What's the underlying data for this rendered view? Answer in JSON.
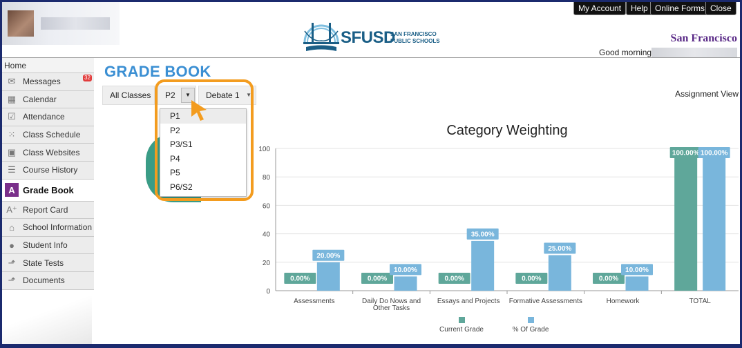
{
  "header": {
    "buttons": [
      "My Account",
      "Help",
      "Online Forms",
      "Close"
    ],
    "logo_text": "SFUSD",
    "logo_sub1": "SAN FRANCISCO",
    "logo_sub2": "PUBLIC SCHOOLS",
    "district": "San Francisco",
    "greeting": "Good morning"
  },
  "sidebar": {
    "home": "Home",
    "messages_badge": "32",
    "items": [
      {
        "label": "Messages",
        "icon": "messages-icon"
      },
      {
        "label": "Calendar",
        "icon": "calendar-icon"
      },
      {
        "label": "Attendance",
        "icon": "attendance-icon"
      },
      {
        "label": "Class Schedule",
        "icon": "class-schedule-icon"
      },
      {
        "label": "Class Websites",
        "icon": "class-websites-icon"
      },
      {
        "label": "Course History",
        "icon": "course-history-icon"
      },
      {
        "label": "Grade Book",
        "icon": "grade-book-icon"
      },
      {
        "label": "Report Card",
        "icon": "report-card-icon"
      },
      {
        "label": "School Information",
        "icon": "school-information-icon"
      },
      {
        "label": "Student Info",
        "icon": "student-info-icon"
      },
      {
        "label": "State Tests",
        "icon": "state-tests-icon"
      },
      {
        "label": "Documents",
        "icon": "documents-icon"
      }
    ]
  },
  "main": {
    "title": "GRADE BOOK",
    "all_classes": "All Classes",
    "period_selected": "P2",
    "class_selected": "Debate 1",
    "assignment_view": "Assignment View",
    "period_options": [
      "P1",
      "P2",
      "P3/S1",
      "P4",
      "P5",
      "P6/S2"
    ]
  },
  "colors": {
    "current_grade": "#5fa79a",
    "percent_of_grade": "#79b6dc",
    "accent_orange": "#f39c1f",
    "title_blue": "#3b8fd3"
  },
  "chart_data": {
    "type": "bar",
    "title": "Category Weighting",
    "categories": [
      "Assessments",
      "Daily Do Nows and Other Tasks",
      "Essays and Projects",
      "Formative Assessments",
      "Homework",
      "TOTAL"
    ],
    "category_labels": [
      [
        "Assessments"
      ],
      [
        "Daily Do Nows and",
        "Other Tasks"
      ],
      [
        "Essays and Projects"
      ],
      [
        "Formative Assessments"
      ],
      [
        "Homework"
      ],
      [
        "TOTAL"
      ]
    ],
    "series": [
      {
        "name": "Current Grade",
        "values": [
          0,
          0,
          0,
          0,
          0,
          100
        ],
        "labels": [
          "0.00%",
          "0.00%",
          "0.00%",
          "0.00%",
          "0.00%",
          "100.00%"
        ]
      },
      {
        "name": "% Of Grade",
        "values": [
          20,
          10,
          35,
          25,
          10,
          100
        ],
        "labels": [
          "20.00%",
          "10.00%",
          "35.00%",
          "25.00%",
          "10.00%",
          "100.00%"
        ]
      }
    ],
    "ylim": [
      0,
      100
    ],
    "yticks": [
      "0",
      "20",
      "40",
      "60",
      "80",
      "100"
    ],
    "legend_position": "bottom"
  }
}
